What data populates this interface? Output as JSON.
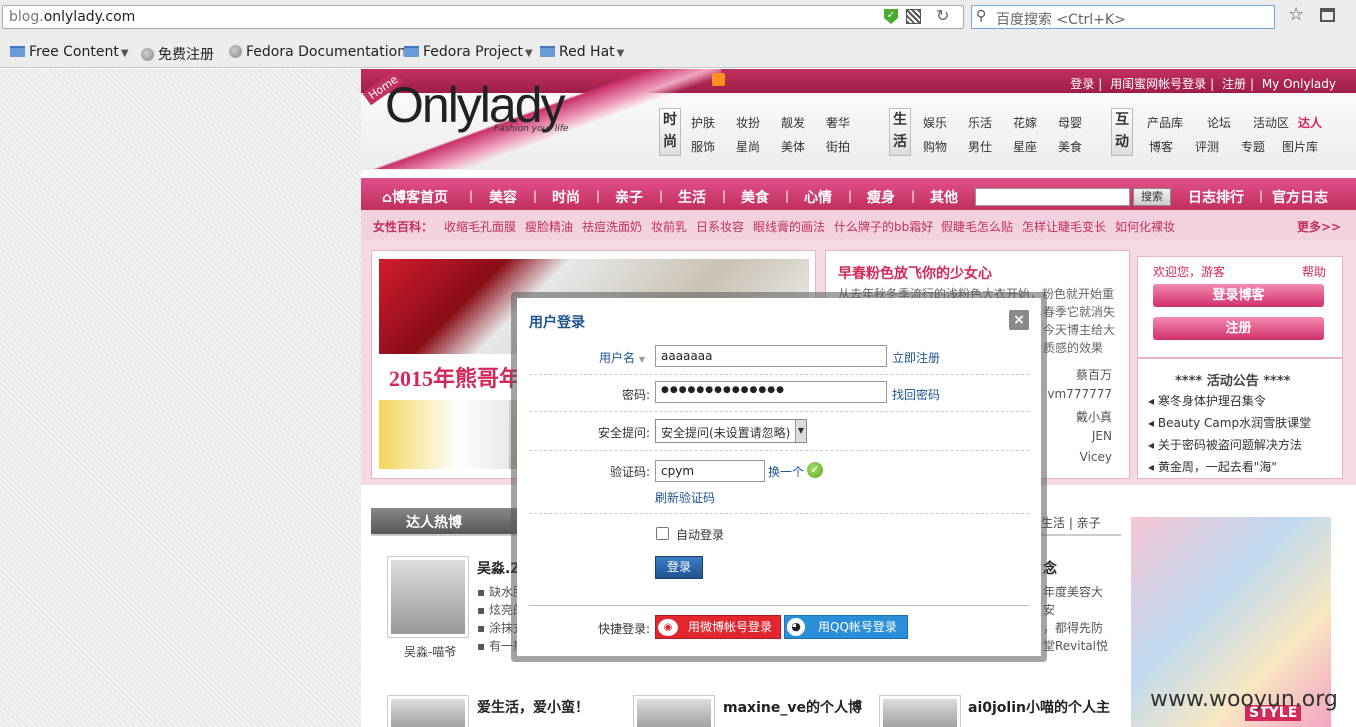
{
  "browser": {
    "url_host_prefix": "blog.",
    "url_host_domain": "onlylady.com",
    "search_placeholder": "百度搜索 <Ctrl+K>",
    "bookmarks": [
      "Free Content",
      "免费注册",
      "Fedora Documentation",
      "Fedora Project",
      "Red Hat"
    ]
  },
  "site": {
    "logo": "Onlylady",
    "logo_sub": "Fashion your life",
    "home_tag": "Home",
    "top_links": [
      "登录",
      "用闺蜜网帐号登录",
      "注册",
      "My Onlylady"
    ],
    "categories": [
      {
        "head": [
          "时",
          "尚"
        ],
        "items": [
          "护肤",
          "妆扮",
          "靓发",
          "奢华",
          "服饰",
          "星尚",
          "美体",
          "街拍"
        ]
      },
      {
        "head": [
          "生",
          "活"
        ],
        "items": [
          "娱乐",
          "乐活",
          "花嫁",
          "母婴",
          "购物",
          "男仕",
          "星座",
          "美食"
        ]
      },
      {
        "head": [
          "互",
          "动"
        ],
        "items": [
          "产品库",
          "论坛",
          "活动区",
          "达人",
          "博客",
          "评测",
          "专题",
          "图片库"
        ]
      }
    ],
    "nav": [
      "博客首页",
      "美容",
      "时尚",
      "亲子",
      "生活",
      "美食",
      "心情",
      "瘦身",
      "其他"
    ],
    "nav_search_btn": "搜索",
    "nav_right": [
      "日志排行",
      "官方日志"
    ],
    "encyclopedia_title": "女性百科：",
    "encyclopedia": [
      "收缩毛孔面膜",
      "瘦脸精油",
      "祛痘洗面奶",
      "妆前乳",
      "日系妆容",
      "眼线膏的画法",
      "什么牌子的bb霜好",
      "假睫毛怎么贴",
      "怎样让睫毛变长",
      "如何化裸妆"
    ],
    "encyclopedia_more": "更多>>",
    "slide_title": "2015年熊哥年",
    "article": {
      "title": "早春粉色放飞你的少女心",
      "lines": [
        "从去年秋冬季流行的浅粉色大衣开始，粉色就开始重",
        "春季它就消失",
        "今天博主给大",
        "质感的效果"
      ],
      "names": [
        "蔡百万",
        "vm777777",
        "戴小真",
        "JEN",
        "Vicey"
      ]
    },
    "welcome": "欢迎您，游客",
    "help": "帮助",
    "login_blog_btn": "登录博客",
    "register_btn": "注册",
    "notice_title": "**** 活动公告 ****",
    "notices": [
      "寒冬身体护理召集令",
      "Beauty Camp水润雪肤课堂",
      "关于密码被盗问题解决方法",
      "黄金周，一起去看\"海\""
    ],
    "tab_left": "达人热博",
    "tabs_right": "生活 | 亲子",
    "bloggers": [
      {
        "name": "吴淼-喵爷",
        "title": "吴淼.Z",
        "lines": [
          "缺水肌",
          "炫亮的",
          "涂抹式",
          "有一瓶"
        ]
      },
      {
        "title": "爱生活，爱小蛮！"
      },
      {
        "title": "maxine_ve的个人博"
      },
      {
        "title": "ai0jolin小喵的个人主"
      }
    ],
    "right_snippets": [
      "年度美容大",
      "安",
      "，都得先防",
      "堂Revital悦"
    ],
    "right_title_snippet": "念",
    "ad_text": "STYLE",
    "watermark": "www.wooyun.org"
  },
  "modal": {
    "title": "用户登录",
    "close": "×",
    "username_label": "用户名",
    "username_value": "aaaaaaa",
    "register_link": "立即注册",
    "password_label": "密码:",
    "password_value": "●●●●●●●●●●●●●●",
    "find_password_link": "找回密码",
    "security_label": "安全提问:",
    "security_value": "安全提问(未设置请忽略)",
    "captcha_label": "验证码:",
    "captcha_value": "cpym",
    "captcha_change": "换一个",
    "captcha_refresh": "刷新验证码",
    "auto_login": "自动登录",
    "login_btn": "登录",
    "quick_login_label": "快捷登录:",
    "weibo_btn": "用微博帐号登录",
    "qq_btn": "用QQ帐号登录"
  }
}
